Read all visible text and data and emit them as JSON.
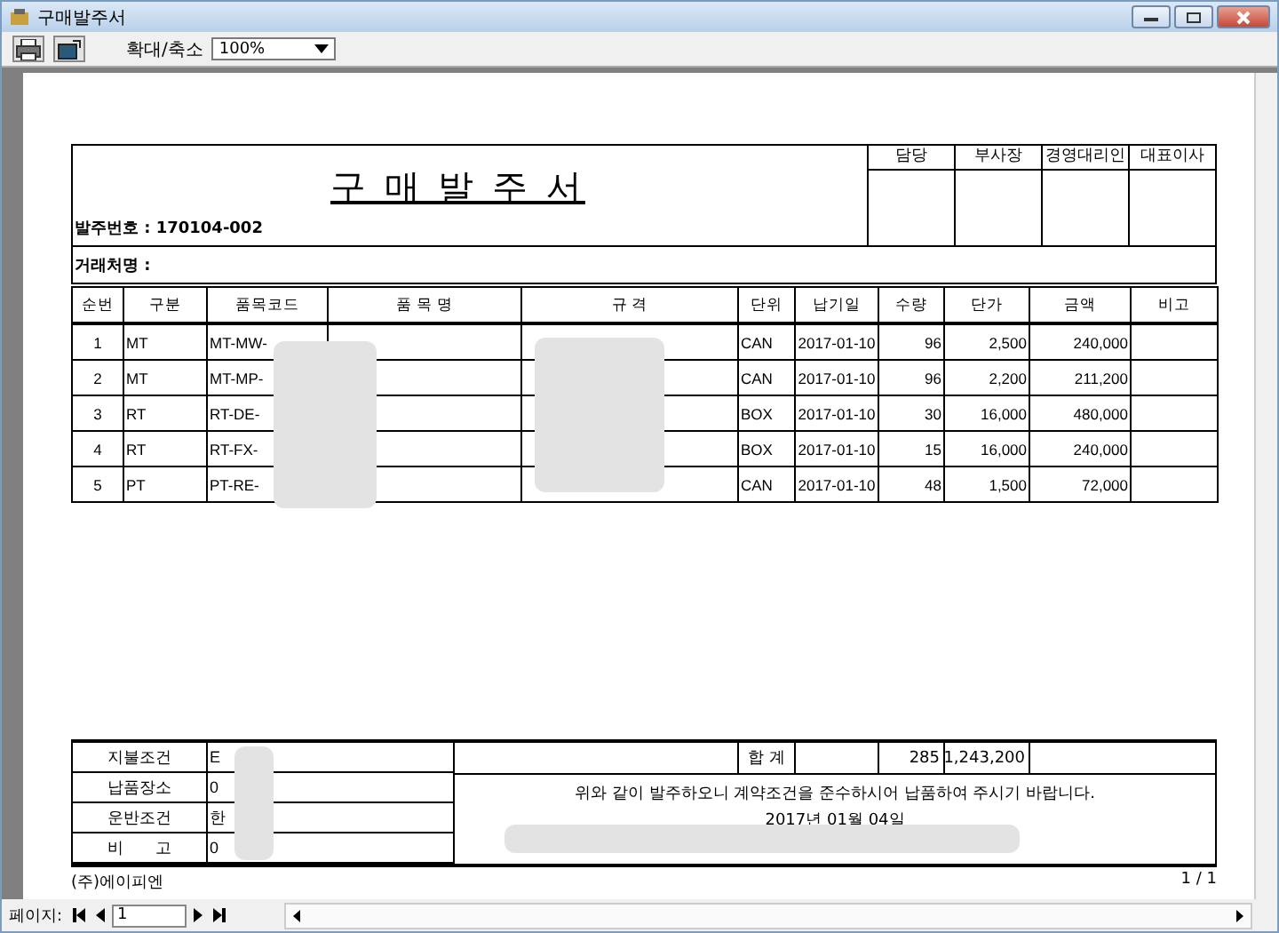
{
  "window": {
    "title": "구매발주서"
  },
  "toolbar": {
    "zoom_label": "확대/축소",
    "zoom_value": "100%"
  },
  "document": {
    "title": "구 매 발 주 서",
    "order_no": "발주번호 : 170104-002",
    "approvals": [
      "담당",
      "부사장",
      "경영대리인",
      "대표이사"
    ],
    "vendor_label": "거래처명 :",
    "columns": [
      "순번",
      "구분",
      "품목코드",
      "품 목 명",
      "규 격",
      "단위",
      "납기일",
      "수량",
      "단가",
      "금액",
      "비고"
    ],
    "rows": [
      {
        "cells": [
          "1",
          "MT",
          "MT-MW-",
          "",
          "",
          "CAN",
          "2017-01-10",
          "96",
          "2,500",
          "240,000",
          ""
        ]
      },
      {
        "cells": [
          "2",
          "MT",
          "MT-MP-",
          "",
          "",
          "CAN",
          "2017-01-10",
          "96",
          "2,200",
          "211,200",
          ""
        ]
      },
      {
        "cells": [
          "3",
          "RT",
          "RT-DE-",
          "",
          "",
          "BOX",
          "2017-01-10",
          "30",
          "16,000",
          "480,000",
          ""
        ]
      },
      {
        "cells": [
          "4",
          "RT",
          "RT-FX-",
          "",
          "",
          "BOX",
          "2017-01-10",
          "15",
          "16,000",
          "240,000",
          ""
        ]
      },
      {
        "cells": [
          "5",
          "PT",
          "PT-RE-",
          "",
          "",
          "CAN",
          "2017-01-10",
          "48",
          "1,500",
          "72,000",
          ""
        ]
      }
    ],
    "terms": [
      {
        "label": "지불조건",
        "value": "E"
      },
      {
        "label": "납품장소",
        "value": "0"
      },
      {
        "label": "운반조건",
        "value": "한"
      },
      {
        "label": "비　　고",
        "value": "0"
      }
    ],
    "total_label": "합 계",
    "total_qty": "285",
    "total_amount": "1,243,200",
    "notice": "위와 같이 발주하오니 계약조건을 준수하시어 납품하여 주시기 바랍니다.",
    "date": "2017년 01월 04일",
    "company": "(주)에이피엔",
    "page_indicator": "1 / 1"
  },
  "pager": {
    "label": "페이지:",
    "page": "1"
  }
}
